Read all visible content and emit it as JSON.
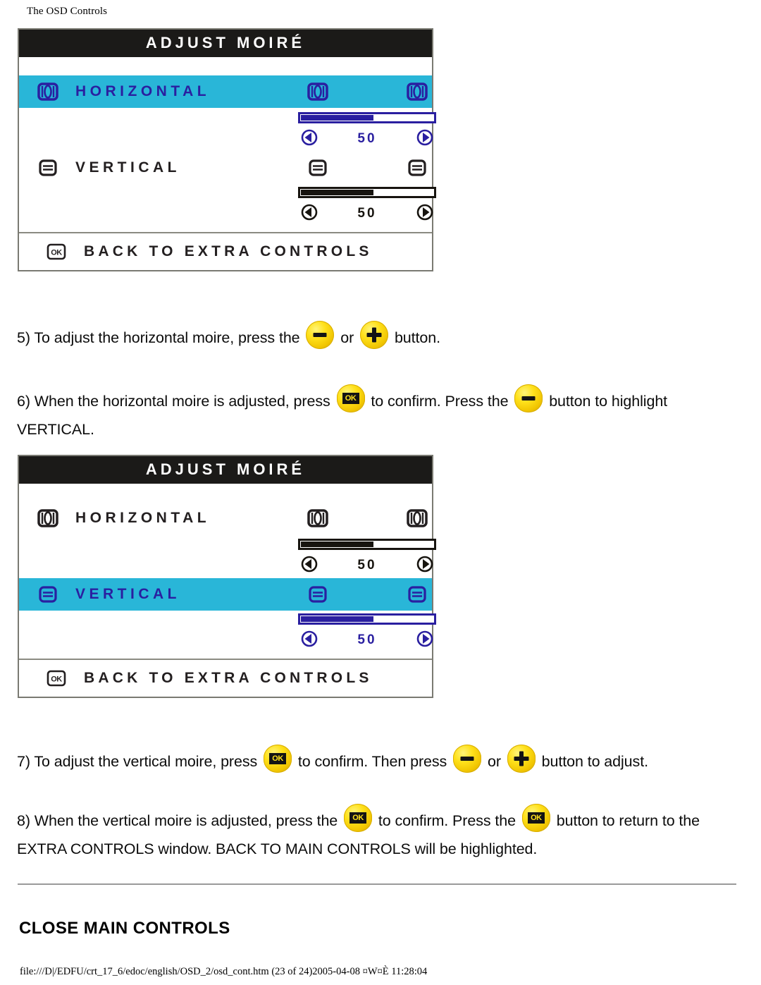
{
  "page": {
    "header": "The OSD Controls",
    "section_heading": "CLOSE MAIN CONTROLS",
    "footer": "file:///D|/EDFU/crt_17_6/edoc/english/OSD_2/osd_cont.htm (23 of 24)2005-04-08 ¤W¤È 11:28:04"
  },
  "colors": {
    "highlight": "#29b6d8",
    "title_bar": "#1b1a18",
    "accent_blue": "#2a1fa0",
    "dark": "#17140f",
    "button_yellow": "#ffe11c",
    "panel_border": "#7a7a72"
  },
  "osd_panel_1": {
    "title": "ADJUST MOIRÉ",
    "rows": [
      {
        "label": "HORIZONTAL",
        "icon": "horizontal-moire-icon",
        "highlighted": true,
        "value": "50",
        "fill_percent": 55,
        "left_arrow": "left-arrow-icon",
        "right_arrow": "right-arrow-icon"
      },
      {
        "label": "VERTICAL",
        "icon": "vertical-moire-icon",
        "highlighted": false,
        "value": "50",
        "fill_percent": 55,
        "left_arrow": "left-arrow-icon",
        "right_arrow": "right-arrow-icon"
      }
    ],
    "footer": {
      "label": "BACK TO EXTRA CONTROLS",
      "icon": "ok-button-icon"
    }
  },
  "osd_panel_2": {
    "title": "ADJUST MOIRÉ",
    "rows": [
      {
        "label": "HORIZONTAL",
        "icon": "horizontal-moire-icon",
        "highlighted": false,
        "value": "50",
        "fill_percent": 55,
        "left_arrow": "left-arrow-icon",
        "right_arrow": "right-arrow-icon"
      },
      {
        "label": "VERTICAL",
        "icon": "vertical-moire-icon",
        "highlighted": true,
        "value": "50",
        "fill_percent": 55,
        "left_arrow": "left-arrow-icon",
        "right_arrow": "right-arrow-icon"
      }
    ],
    "footer": {
      "label": "BACK TO EXTRA CONTROLS",
      "icon": "ok-button-icon"
    }
  },
  "instructions": {
    "step5": {
      "part1": "5) To adjust the horizontal moire, press the",
      "part2": "or",
      "part3": "button.",
      "buttons": [
        "minus-button",
        "plus-button"
      ]
    },
    "step6": {
      "part1": "6) When the horizontal moire is adjusted, press",
      "part2": "to confirm. Press the",
      "part3": "button to highlight VERTICAL.",
      "buttons": [
        "ok-button",
        "minus-button"
      ]
    },
    "step7": {
      "part1": "7) To adjust the vertical moire, press",
      "part2": "to confirm. Then press",
      "part3": "or",
      "part4": "button to adjust.",
      "buttons": [
        "ok-button",
        "minus-button",
        "plus-button"
      ]
    },
    "step8": {
      "part1": "8) When the vertical moire is adjusted, press the",
      "part2": "to confirm. Press the",
      "part3": "button to return to the EXTRA CONTROLS window. BACK TO MAIN CONTROLS will be highlighted.",
      "buttons": [
        "ok-button",
        "ok-button"
      ]
    }
  }
}
